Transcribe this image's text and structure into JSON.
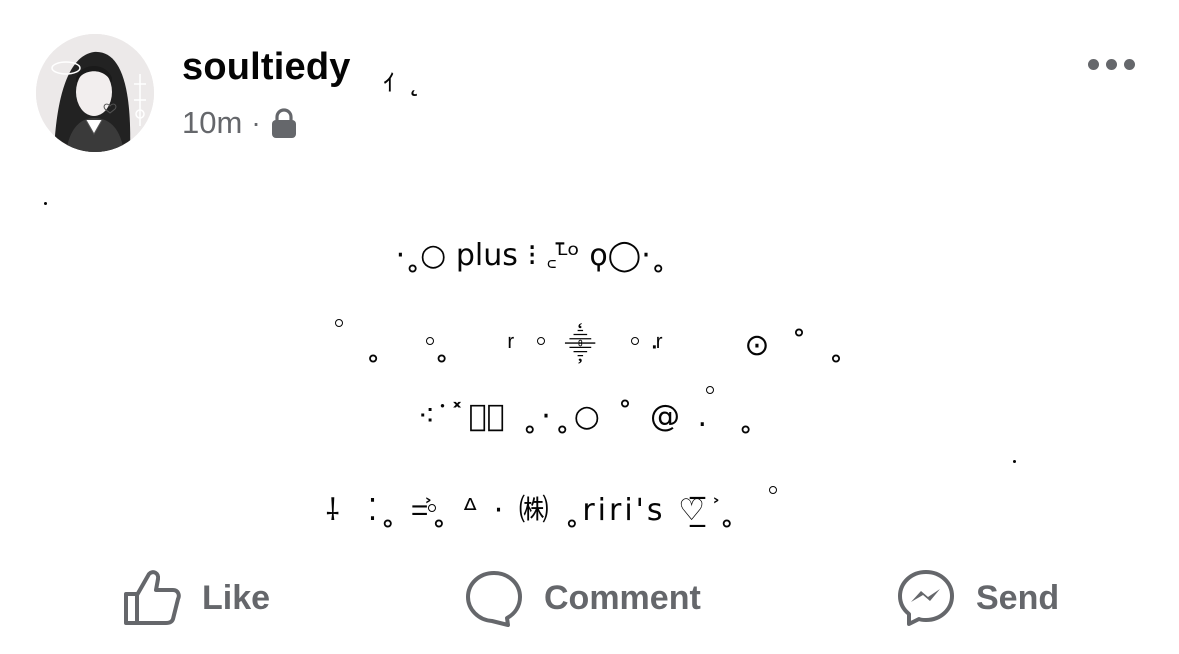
{
  "post": {
    "author": "soultiedy",
    "author_deco": "ｨ ˛",
    "timestamp": "10m",
    "separator": "·",
    "privacy_icon": "lock-icon",
    "avatar_icon": "profile-photo",
    "more_icon": "more-options-icon",
    "lines": [
      "·˳○ plus ⁝ ꜀ᴸ̄ᵒ ϙ◯·˳",
      "˳ ˳  ͬ ⸎ ·ͬ  ⊙˚˳",
      "⁖ᣟ˟ガ͐ ˳·˳○ ˚ @ .  ˳",
      "⸸  ⁚˳ =͐˳ ᐞ · ㈱ ˳riri's ♡̲̅ ͐˳"
    ]
  },
  "actions": {
    "like": "Like",
    "comment": "Comment",
    "send": "Send"
  },
  "colors": {
    "text": "#050505",
    "secondary": "#65676b",
    "background": "#ffffff"
  }
}
